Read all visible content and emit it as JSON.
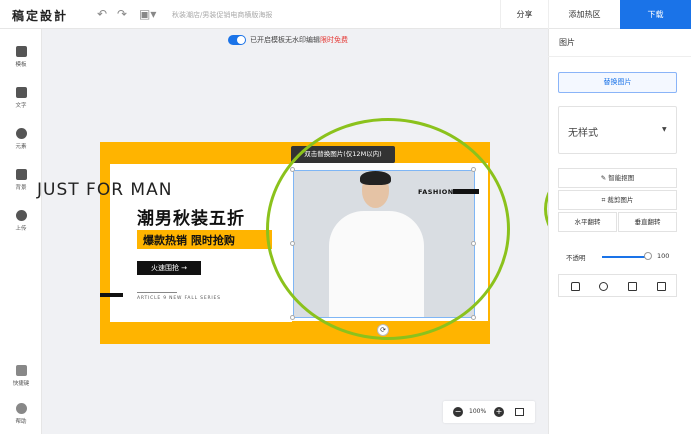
{
  "topbar": {
    "brand": "稿定設計",
    "doc_title": "秋装潮店/男装促销电商横版海报",
    "share": "分享",
    "add_hotspot": "添加热区",
    "download": "下载"
  },
  "sidebar": {
    "items": [
      {
        "label": "模板",
        "icon": "template-icon"
      },
      {
        "label": "文字",
        "icon": "text-icon"
      },
      {
        "label": "元素",
        "icon": "elements-icon"
      },
      {
        "label": "背景",
        "icon": "background-icon"
      },
      {
        "label": "上传",
        "icon": "upload-icon"
      }
    ],
    "bottom": [
      {
        "label": "快捷键",
        "icon": "keyboard-icon"
      },
      {
        "label": "帮助",
        "icon": "help-icon"
      }
    ]
  },
  "notice": {
    "text": "已开启模板无水印编辑",
    "highlight": "限时免费"
  },
  "poster": {
    "title_en": "JUST FOR MAN",
    "headline": "潮男秋装五折",
    "sub": "爆款热销 限时抢购",
    "cta": "火速围抢 →",
    "tagline": "ARTICLE 9 NEW FALL SERIES",
    "fashion": "FASHION"
  },
  "canvas_tooltip": "双击替换图片(仅12M以内)",
  "zoom": {
    "value": "100%"
  },
  "panel": {
    "title": "图片",
    "replace": "替换图片",
    "style_value": "无样式",
    "smart_cutout": "智能抠图",
    "crop": "裁剪图片",
    "flip_h": "水平翻转",
    "flip_v": "垂直翻转",
    "opacity_label": "不透明",
    "opacity_value": "100"
  },
  "colors": {
    "accent": "#1a73e8",
    "poster_yellow": "#ffb400",
    "annotation_green": "#8bc21c",
    "promo_red": "#e53935"
  }
}
